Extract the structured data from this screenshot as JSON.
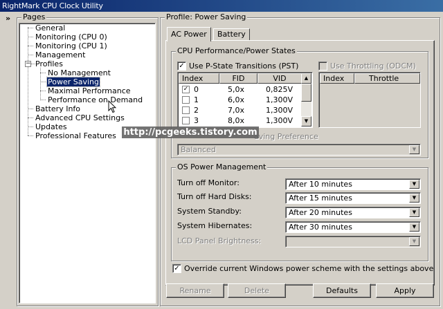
{
  "window": {
    "title": "RightMark CPU Clock Utility"
  },
  "left": {
    "expander": "»",
    "group_label": "Pages",
    "tree": [
      {
        "label": "General"
      },
      {
        "label": "Monitoring (CPU 0)"
      },
      {
        "label": "Monitoring (CPU 1)"
      },
      {
        "label": "Management"
      },
      {
        "label": "Profiles",
        "expander": "−"
      },
      {
        "label": "No Management"
      },
      {
        "label": "Power Saving",
        "selected": true
      },
      {
        "label": "Maximal Performance"
      },
      {
        "label": "Performance on Demand"
      },
      {
        "label": "Battery Info"
      },
      {
        "label": "Advanced CPU Settings"
      },
      {
        "label": "Updates"
      },
      {
        "label": "Professional Features"
      }
    ]
  },
  "right": {
    "group_label": "Profile: Power Saving",
    "tabs": [
      {
        "label": "AC Power",
        "active": true
      },
      {
        "label": "Battery",
        "active": false
      }
    ],
    "cpu_states": {
      "group_label": "CPU Performance/Power States",
      "pstate": {
        "label": "Use P-State Transitions (PST)",
        "checked": true,
        "columns": [
          "Index",
          "FID",
          "VID"
        ],
        "rows": [
          {
            "checked": true,
            "index": "0",
            "fid": "5,0x",
            "vid": "0,825V"
          },
          {
            "checked": false,
            "index": "1",
            "fid": "6,0x",
            "vid": "1,300V"
          },
          {
            "checked": false,
            "index": "2",
            "fid": "7,0x",
            "vid": "1,300V"
          },
          {
            "checked": false,
            "index": "3",
            "fid": "8,0x",
            "vid": "1,300V"
          }
        ]
      },
      "throttling": {
        "label": "Use Throttling (ODCM)",
        "checked": false,
        "columns": [
          "Index",
          "Throttle"
        ]
      },
      "preference_label": "aving Preference",
      "preference_value": "Balanced"
    },
    "os_power": {
      "group_label": "OS Power Management",
      "rows": [
        {
          "label": "Turn off Monitor:",
          "value": "After 10 minutes",
          "enabled": true
        },
        {
          "label": "Turn off Hard Disks:",
          "value": "After 15 minutes",
          "enabled": true
        },
        {
          "label": "System Standby:",
          "value": "After 20 minutes",
          "enabled": true
        },
        {
          "label": "System Hibernates:",
          "value": "After 30 minutes",
          "enabled": true
        },
        {
          "label": "LCD Panel Brightness:",
          "value": "",
          "enabled": false
        }
      ]
    },
    "override": {
      "label": "Override current Windows power scheme with the settings above",
      "checked": true
    },
    "buttons": {
      "rename": "Rename",
      "delete": "Delete",
      "defaults": "Defaults",
      "apply": "Apply"
    }
  },
  "watermark": "http://pcgeeks.tistory.com",
  "icons": {
    "combo_arrow": "▼",
    "scroll_up": "▲",
    "scroll_down": "▼",
    "check": "✓"
  },
  "colors": {
    "titlebar_start": "#0a246a",
    "titlebar_end": "#3a6ea5",
    "face": "#d4d0c8",
    "selection": "#0a246a"
  }
}
